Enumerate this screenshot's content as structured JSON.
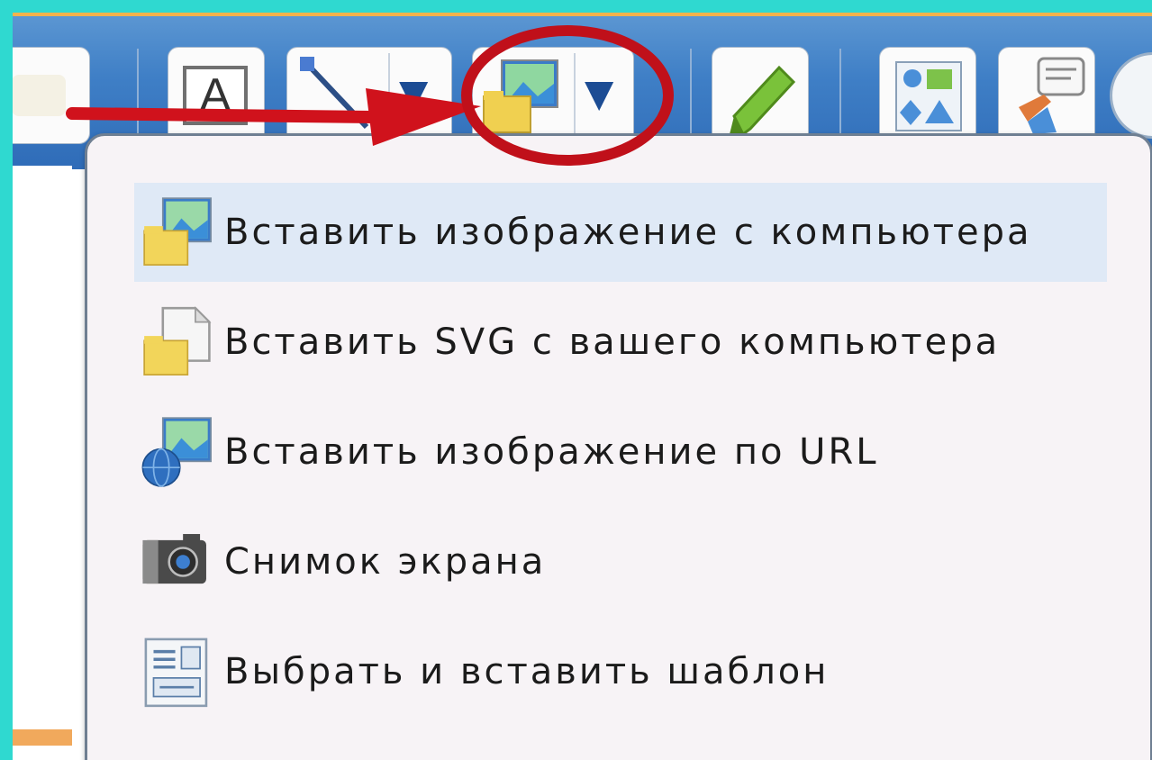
{
  "toolbar": {
    "buttons": [
      {
        "name": "blank-tool",
        "icon": "blank-icon"
      },
      {
        "name": "text-tool",
        "icon": "text-a-icon",
        "glyph": "A"
      },
      {
        "name": "line-tool",
        "icon": "line-icon"
      },
      {
        "name": "insert-image-tool",
        "icon": "image-folder-icon"
      },
      {
        "name": "marker-tool",
        "icon": "green-marker-icon"
      },
      {
        "name": "shapes-tool",
        "icon": "shapes-icon"
      },
      {
        "name": "callout-tool",
        "icon": "callout-icon"
      }
    ],
    "dropdown_glyph": "▼"
  },
  "menu": {
    "items": [
      {
        "label": "Вставить изображение с компьютера",
        "icon": "image-from-computer-icon",
        "highlighted": true
      },
      {
        "label": "Вставить SVG с вашего компьютера",
        "icon": "svg-file-icon",
        "highlighted": false
      },
      {
        "label": "Вставить изображение по URL",
        "icon": "image-url-globe-icon",
        "highlighted": false
      },
      {
        "label": "Снимок экрана",
        "icon": "camera-icon",
        "highlighted": false
      },
      {
        "label": "Выбрать и вставить шаблон",
        "icon": "template-icon",
        "highlighted": false
      }
    ]
  },
  "colors": {
    "background_frame": "#2fd9d0",
    "toolbar_blue": "#3f7fc6",
    "menu_bg": "#f7f3f6",
    "highlight_bg": "#dfe9f6",
    "annotation_red": "#d0121c"
  }
}
